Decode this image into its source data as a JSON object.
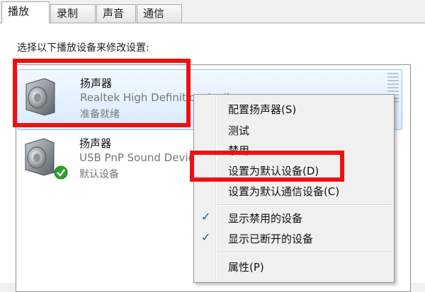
{
  "tabs": [
    {
      "label": "播放"
    },
    {
      "label": "录制"
    },
    {
      "label": "声音"
    },
    {
      "label": "通信"
    }
  ],
  "instruction": "选择以下播放设备来修改设置:",
  "devices": [
    {
      "name": "扬声器",
      "description": "Realtek High Definition Audio",
      "status": "准备就绪",
      "icon": "speaker-icon"
    },
    {
      "name": "扬声器",
      "description": "USB PnP Sound Device",
      "status": "默认设备",
      "icon": "speaker-icon",
      "badge": "green-check-icon"
    }
  ],
  "context_menu": {
    "items": [
      {
        "label": "配置扬声器(S)"
      },
      {
        "label": "测试"
      },
      {
        "label": "禁用"
      },
      {
        "label": "设置为默认设备(D)"
      },
      {
        "label": "设置为默认通信设备(C)"
      },
      {
        "label": "显示禁用的设备",
        "checked": true
      },
      {
        "label": "显示已断开的设备",
        "checked": true
      },
      {
        "label": "属性(P)"
      }
    ],
    "check_glyph": "✓"
  },
  "colors": {
    "highlight_red": "#ee1111",
    "selection_blue": "#d9ebff",
    "check_blue": "#1a4fa0",
    "status_green": "#2aa32a"
  }
}
